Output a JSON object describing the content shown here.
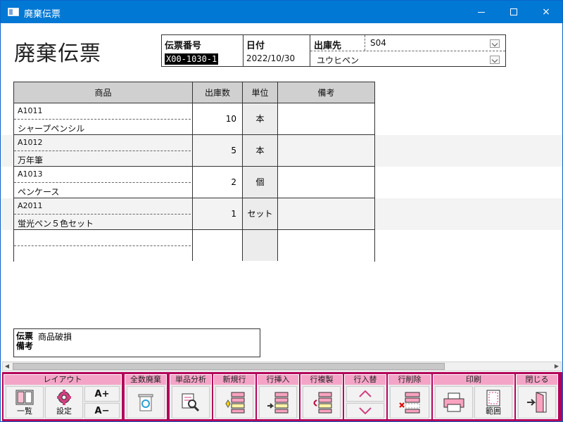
{
  "window": {
    "title": "廃棄伝票",
    "controls": {
      "minimize": "minimize-icon",
      "maximize": "maximize-icon",
      "close": "×"
    }
  },
  "form": {
    "title": "廃棄伝票",
    "header": {
      "slip_no_label": "伝票番号",
      "slip_no_value": "X00-1030-1",
      "date_label": "日付",
      "date_value": "2022/10/30",
      "dest_label": "出庫先",
      "dest_code": "S04",
      "dest_name": "ユウヒペン"
    },
    "table": {
      "columns": [
        "商品",
        "出庫数",
        "単位",
        "備考"
      ],
      "rows": [
        {
          "code": "A1011",
          "name": "シャープペンシル",
          "qty": "10",
          "unit": "本",
          "note": ""
        },
        {
          "code": "A1012",
          "name": "万年筆",
          "qty": "5",
          "unit": "本",
          "note": ""
        },
        {
          "code": "A1013",
          "name": "ペンケース",
          "qty": "2",
          "unit": "個",
          "note": ""
        },
        {
          "code": "A2011",
          "name": "蛍光ペン５色セット",
          "qty": "1",
          "unit": "セット",
          "note": ""
        },
        {
          "code": "",
          "name": "",
          "qty": "",
          "unit": "",
          "note": ""
        }
      ]
    },
    "memo": {
      "label": "伝票備考",
      "value": "商品破損"
    }
  },
  "toolbar": {
    "groups": {
      "layout": "レイアウト",
      "all_dispose": "全数廃棄",
      "item_analysis": "単品分析",
      "new_row": "新規行",
      "insert_row": "行挿入",
      "copy_row": "行複製",
      "swap_row": "行入替",
      "delete_row": "行削除",
      "print": "印刷",
      "close": "閉じる"
    },
    "buttons": {
      "list": "一覧",
      "settings": "設定",
      "font_up": "A+",
      "font_down": "A−",
      "range": "範囲"
    }
  },
  "colors": {
    "titlebar": "#0078d4",
    "toolbar_bg": "#b30059",
    "group_label": "#f4a5c7",
    "header_row": "#d0d0d0"
  }
}
